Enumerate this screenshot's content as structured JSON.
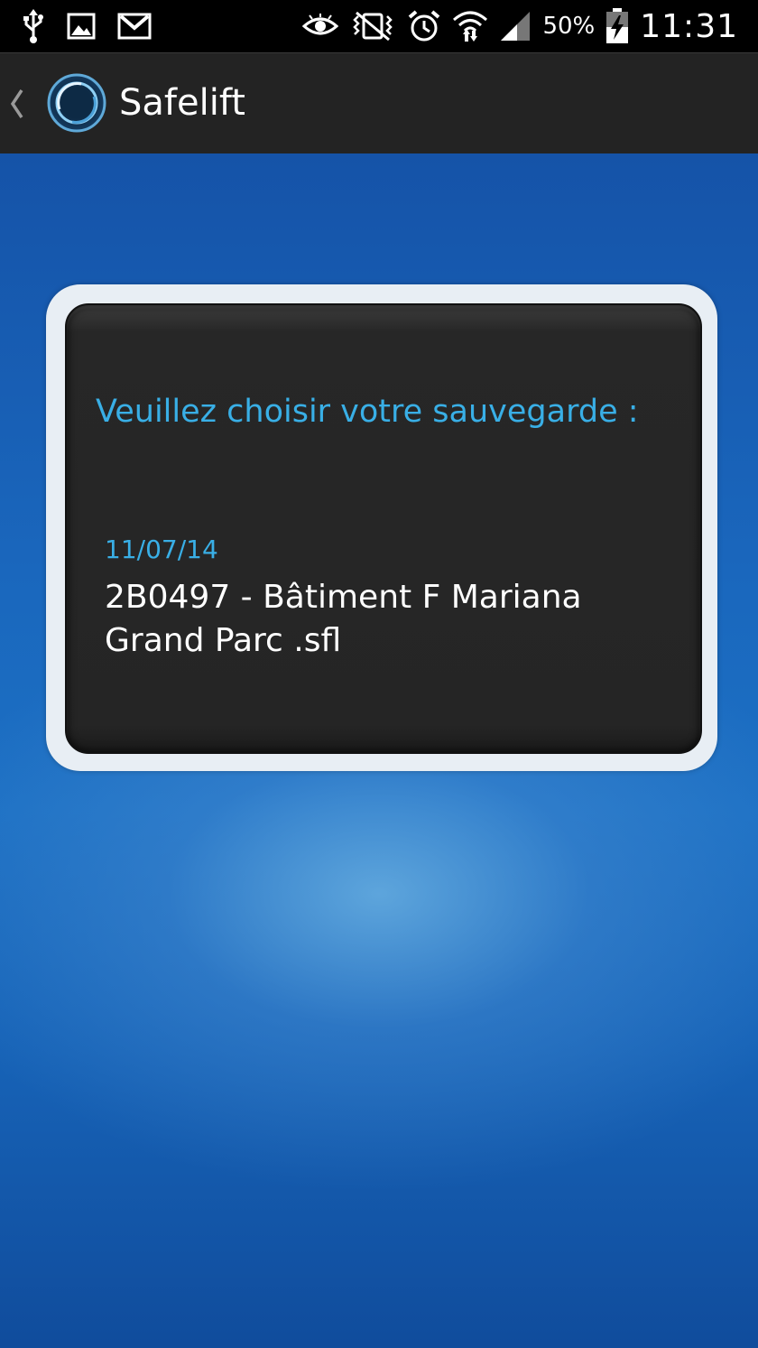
{
  "status_bar": {
    "icons_left": [
      "usb-icon",
      "image-icon",
      "gmail-icon"
    ],
    "icons_right": [
      "eye-icon",
      "vibrate-icon",
      "alarm-icon",
      "wifi-icon",
      "signal-icon"
    ],
    "battery_percent": "50%",
    "battery_level": 0.5,
    "time": "11:31"
  },
  "action_bar": {
    "title": "Safelift",
    "logo_icon": "safelift-logo-icon",
    "background": "#232323"
  },
  "dialog": {
    "prompt": "Veuillez choisir votre sauvegarde :",
    "items": [
      {
        "date": "11/07/14",
        "name": "2B0497 - Bâtiment F Mariana Grand Parc .sfl"
      }
    ]
  },
  "colors": {
    "accent": "#39afe6",
    "card_background": "#252525",
    "card_frame": "#e8eef4",
    "page_background": "#1a5fb0"
  }
}
